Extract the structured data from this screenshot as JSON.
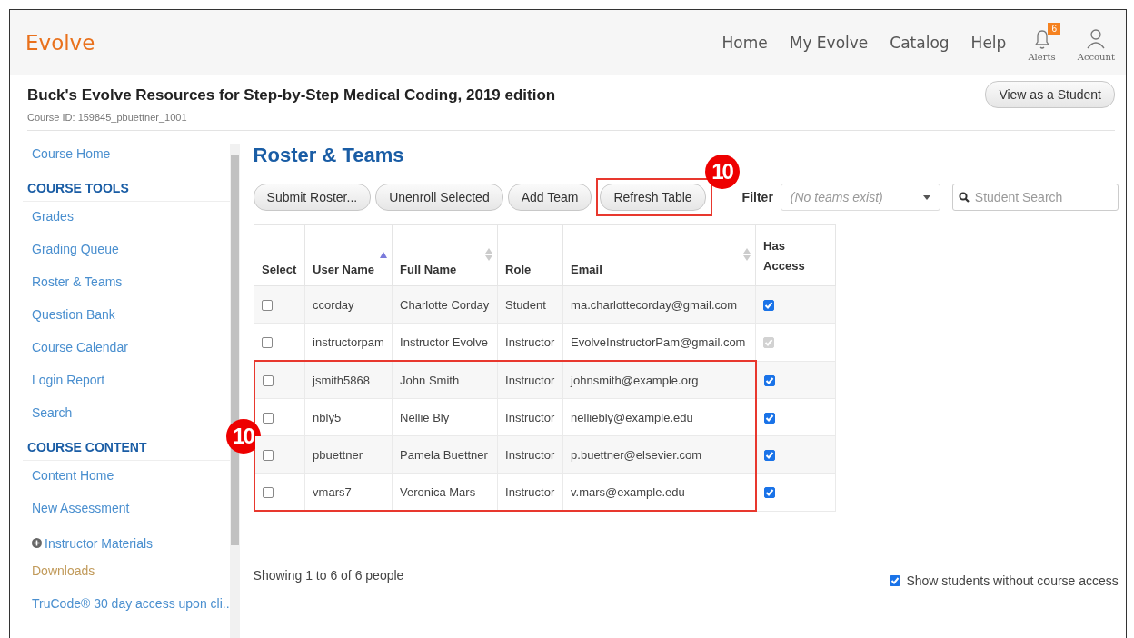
{
  "brand": "Evolve",
  "nav": [
    "Home",
    "My Evolve",
    "Catalog",
    "Help"
  ],
  "alerts": {
    "label": "Alerts",
    "count": "6"
  },
  "account": {
    "label": "Account"
  },
  "course": {
    "title": "Buck's Evolve Resources for Step-by-Step Medical Coding, 2019 edition",
    "id": "Course ID: 159845_pbuettner_1001",
    "view_button": "View as a Student"
  },
  "sidebar": {
    "items": [
      {
        "kind": "link",
        "label": "Course Home",
        "visited": false
      },
      {
        "kind": "heading",
        "label": "COURSE TOOLS"
      },
      {
        "kind": "link",
        "label": "Grades",
        "visited": false
      },
      {
        "kind": "link",
        "label": "Grading Queue",
        "visited": false
      },
      {
        "kind": "link",
        "label": "Roster & Teams",
        "visited": false
      },
      {
        "kind": "link",
        "label": "Question Bank",
        "visited": false
      },
      {
        "kind": "link",
        "label": "Course Calendar",
        "visited": false
      },
      {
        "kind": "link",
        "label": "Login Report",
        "visited": false
      },
      {
        "kind": "link",
        "label": "Search",
        "visited": false
      },
      {
        "kind": "heading",
        "label": "COURSE CONTENT"
      },
      {
        "kind": "link",
        "label": "Content Home",
        "visited": false
      },
      {
        "kind": "link",
        "label": "New Assessment",
        "visited": false
      },
      {
        "kind": "expander",
        "label": "Instructor Materials",
        "visited": false
      },
      {
        "kind": "link",
        "label": "Downloads",
        "visited": true
      },
      {
        "kind": "link",
        "label": "TruCode® 30 day access upon cli..",
        "visited": false
      }
    ]
  },
  "page_title": "Roster & Teams",
  "toolbar": {
    "buttons": [
      {
        "label": "Submit Roster...",
        "highlighted": false
      },
      {
        "label": "Unenroll Selected",
        "highlighted": false
      },
      {
        "label": "Add Team",
        "highlighted": false
      },
      {
        "label": "Refresh Table",
        "highlighted": true,
        "callout": "10"
      }
    ],
    "filter_label": "Filter",
    "filter": {
      "placeholder": "(No teams exist)"
    },
    "search": {
      "placeholder": "Student Search"
    }
  },
  "table": {
    "callout": "10",
    "columns": [
      {
        "label": "Select",
        "sortable": false,
        "sorted": false
      },
      {
        "label": "User Name",
        "sortable": true,
        "sorted": true
      },
      {
        "label": "Full Name",
        "sortable": true,
        "sorted": false
      },
      {
        "label": "Role",
        "sortable": false,
        "sorted": false
      },
      {
        "label": "Email",
        "sortable": true,
        "sorted": false
      },
      {
        "label": "Has Access",
        "sortable": false,
        "sorted": false
      }
    ],
    "rows": [
      {
        "selected": false,
        "user": "ccorday",
        "name": "Charlotte Corday",
        "role": "Student",
        "email": "ma.charlottecorday@gmail.com",
        "access": true,
        "access_disabled": false,
        "highlighted": false
      },
      {
        "selected": false,
        "user": "instructorpam",
        "name": "Instructor Evolve",
        "role": "Instructor",
        "email": "EvolveInstructorPam@gmail.com",
        "access": true,
        "access_disabled": true,
        "highlighted": false
      },
      {
        "selected": false,
        "user": "jsmith5868",
        "name": "John Smith",
        "role": "Instructor",
        "email": "johnsmith@example.org",
        "access": true,
        "access_disabled": false,
        "highlighted": true
      },
      {
        "selected": false,
        "user": "nbly5",
        "name": "Nellie Bly",
        "role": "Instructor",
        "email": "nelliebly@example.edu",
        "access": true,
        "access_disabled": false,
        "highlighted": true
      },
      {
        "selected": false,
        "user": "pbuettner",
        "name": "Pamela Buettner",
        "role": "Instructor",
        "email": "p.buettner@elsevier.com",
        "access": true,
        "access_disabled": false,
        "highlighted": true
      },
      {
        "selected": false,
        "user": "vmars7",
        "name": "Veronica Mars",
        "role": "Instructor",
        "email": "v.mars@example.edu",
        "access": true,
        "access_disabled": false,
        "highlighted": true
      }
    ]
  },
  "footer": {
    "showing": "Showing 1 to 6 of 6 people",
    "show_without_access": {
      "label": "Show students without course access",
      "checked": true
    }
  }
}
